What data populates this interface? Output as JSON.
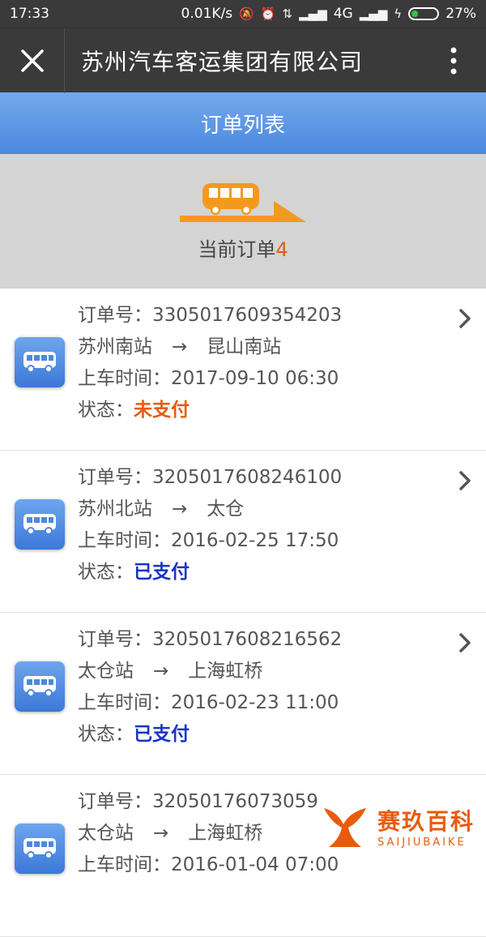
{
  "status_bar": {
    "time": "17:33",
    "speed": "0.01K/s",
    "network": "4G",
    "battery": "27%",
    "battery_level": 0.27
  },
  "title_bar": {
    "title": "苏州汽车客运集团有限公司"
  },
  "header": {
    "title": "订单列表"
  },
  "summary": {
    "label": "当前订单",
    "count": "4"
  },
  "orders": [
    {
      "order_label": "订单号：",
      "order_no": "3305017609354203",
      "from": "苏州南站",
      "arrow": "→",
      "to": "昆山南站",
      "time_label": "上车时间：",
      "time": "2017-09-10 06:30",
      "status_label": "状态：",
      "status": "未支付"
    },
    {
      "order_label": "订单号：",
      "order_no": "3205017608246100",
      "from": "苏州北站",
      "arrow": "→",
      "to": "太仓",
      "time_label": "上车时间：",
      "time": "2016-02-25 17:50",
      "status_label": "状态：",
      "status": "已支付"
    },
    {
      "order_label": "订单号：",
      "order_no": "3205017608216562",
      "from": "太仓站",
      "arrow": "→",
      "to": "上海虹桥",
      "time_label": "上车时间：",
      "time": "2016-02-23 11:00",
      "status_label": "状态：",
      "status": "已支付"
    },
    {
      "order_label": "订单号：",
      "order_no": "32050176073059",
      "from": "太仓站",
      "arrow": "→",
      "to": "上海虹桥",
      "time_label": "上车时间：",
      "time": "2016-01-04 07:00",
      "status_label": "状态：",
      "status": ""
    }
  ],
  "watermark": {
    "cn": "赛玖百科",
    "en": "SAIJIUBAIKE"
  },
  "colors": {
    "accent_orange": "#e85b0c",
    "paid_blue": "#1a34c8",
    "header_blue": "#4c88de",
    "titlebar_dark": "#3a3a3a"
  }
}
